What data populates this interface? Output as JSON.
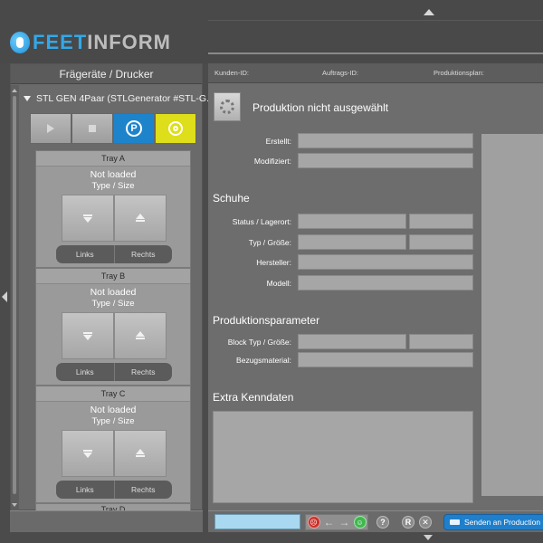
{
  "brand": {
    "logo_part1": "FEET",
    "logo_part2": "INFORM"
  },
  "left_panel": {
    "title": "Frägeräte / Drucker",
    "device": {
      "name": "STL GEN 4Paar (STLGenerator #STL-G...",
      "status": "online"
    },
    "controls": [
      {
        "name": "play",
        "icon": "play-icon"
      },
      {
        "name": "stop",
        "icon": "stop-icon"
      },
      {
        "name": "park",
        "icon": "p-icon",
        "label": "P"
      },
      {
        "name": "target",
        "icon": "target-icon"
      }
    ],
    "trays": [
      {
        "title": "Tray A",
        "status": "Not loaded",
        "type_label": "Type / Size",
        "left_label": "Links",
        "right_label": "Rechts"
      },
      {
        "title": "Tray B",
        "status": "Not loaded",
        "type_label": "Type / Size",
        "left_label": "Links",
        "right_label": "Rechts"
      },
      {
        "title": "Tray C",
        "status": "Not loaded",
        "type_label": "Type / Size",
        "left_label": "Links",
        "right_label": "Rechts"
      }
    ],
    "tray_partial_title": "Tray D"
  },
  "main": {
    "info": {
      "customer_label": "Kunden-ID:",
      "order_label": "Auftrags-ID:",
      "plan_label": "Produktionsplan:"
    },
    "production_title": "Produktion nicht ausgewählt",
    "labels": {
      "created": "Erstellt:",
      "modified": "Modifiziert:",
      "status_location": "Status / Lagerort:",
      "type_size": "Typ / Größe:",
      "manufacturer": "Hersteller:",
      "model": "Modell:",
      "block_type_size": "Block Typ / Größe:",
      "cover_material": "Bezugsmaterial:"
    },
    "sections": {
      "shoes": "Schuhe",
      "production_params": "Produktionsparameter",
      "extra_data": "Extra Kenndaten"
    }
  },
  "bottom_bar": {
    "search_value": "",
    "help_label": "?",
    "r_label": "R",
    "x_label": "✕",
    "send_label": "Senden an Production G"
  },
  "colors": {
    "accent_blue": "#1d84cc",
    "accent_yellow": "#dede1a",
    "status_green": "#3fd43f"
  }
}
